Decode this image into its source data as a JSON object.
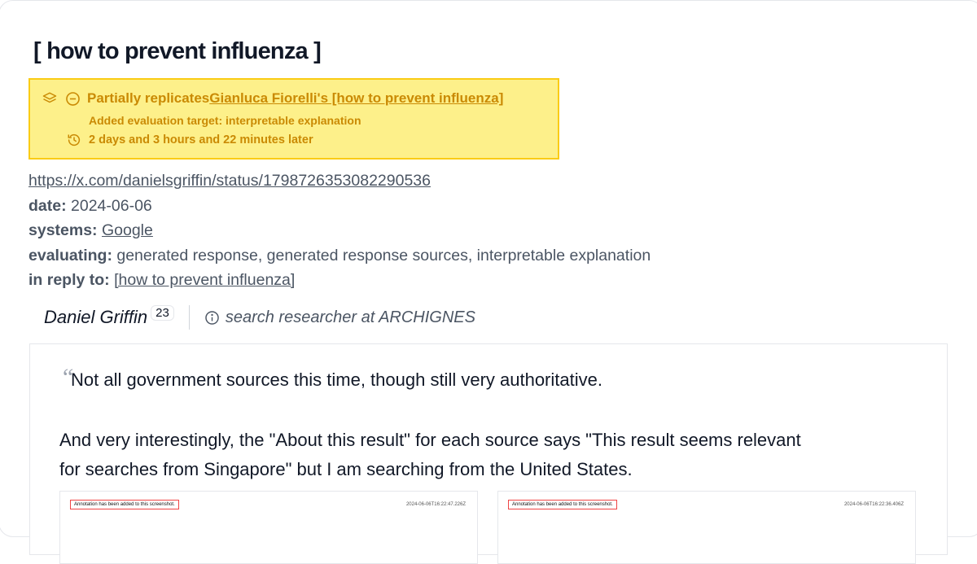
{
  "title": "[ how to prevent influenza ]",
  "replication": {
    "prefix": "Partially replicates ",
    "link_text": "Gianluca Fiorelli's [how to prevent influenza]",
    "added": "Added evaluation target: interpretable explanation",
    "elapsed": "2 days and 3 hours and 22 minutes later",
    "icons": [
      "layers-icon",
      "minus-circle-icon",
      "history-icon"
    ],
    "colors": {
      "background": "#fdf08a",
      "border": "#facc15",
      "text": "#ca8a04"
    }
  },
  "meta": {
    "url": "https://x.com/danielsgriffin/status/1798726353082290536",
    "date_label": "date:",
    "date": "2024-06-06",
    "systems_label": "systems:",
    "systems": "Google",
    "evaluating_label": "evaluating:",
    "evaluating": "generated response, generated response sources, interpretable explanation",
    "reply_label": "in reply to:",
    "reply": "[how to prevent influenza]"
  },
  "author": {
    "name": "Daniel Griffin",
    "count": "23",
    "bio": "search researcher at ARCHIGNES",
    "bio_icon": "info-icon"
  },
  "quote": {
    "mark": "“",
    "line1": "Not all government sources this time, though still very authoritative.",
    "line2": "And very interestingly, the \"About this result\" for each source says \"This result seems relevant",
    "line3": "for searches from Singapore\" but I am searching from the United States."
  },
  "screenshots": [
    {
      "note": "Annotation has been added to this screenshot.",
      "date": "2024-06-06T16:22:47.226Z"
    },
    {
      "note": "Annotation has been added to this screenshot.",
      "date": "2024-06-06T16:22:36.406Z"
    }
  ]
}
